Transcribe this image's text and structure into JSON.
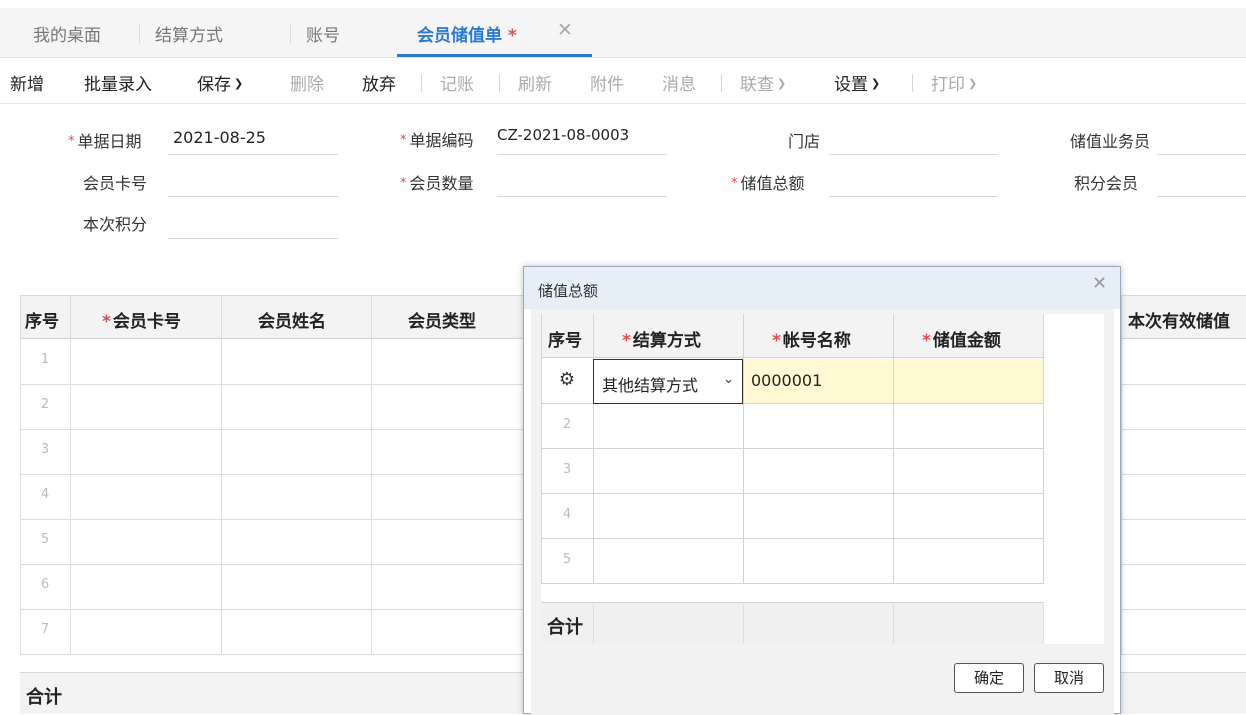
{
  "tabs": [
    {
      "label": "我的桌面"
    },
    {
      "label": "结算方式"
    },
    {
      "label": "账号"
    },
    {
      "label": "会员储值单",
      "star": "*"
    }
  ],
  "toolbar": {
    "new": "新增",
    "batch": "批量录入",
    "save": "保存",
    "delete": "删除",
    "discard": "放弃",
    "post": "记账",
    "refresh": "刷新",
    "attach": "附件",
    "message": "消息",
    "lookup": "联查",
    "settings": "设置",
    "print": "打印"
  },
  "form": {
    "date_label": "单据日期",
    "date_value": "2021-08-25",
    "code_label": "单据编码",
    "code_value": "CZ-2021-08-0003",
    "store_label": "门店",
    "clerk_label": "储值业务员",
    "card_label": "会员卡号",
    "count_label": "会员数量",
    "total_label": "储值总额",
    "points_member_label": "积分会员",
    "points_label": "本次积分",
    "req": "*"
  },
  "grid": {
    "headers": [
      "序号",
      "会员卡号",
      "会员姓名",
      "会员类型",
      "本次有效储值"
    ],
    "rows": [
      "1",
      "2",
      "3",
      "4",
      "5",
      "6",
      "7"
    ],
    "total_label": "合计"
  },
  "dialog": {
    "title": "储值总额",
    "close": "x",
    "headers": [
      "序号",
      "结算方式",
      "帐号名称",
      "储值金额"
    ],
    "rows": [
      "2",
      "3",
      "4",
      "5"
    ],
    "settle_value": "其他结算方式",
    "account_value": "0000001",
    "total_label": "合计",
    "ok": "确定",
    "cancel": "取消"
  }
}
